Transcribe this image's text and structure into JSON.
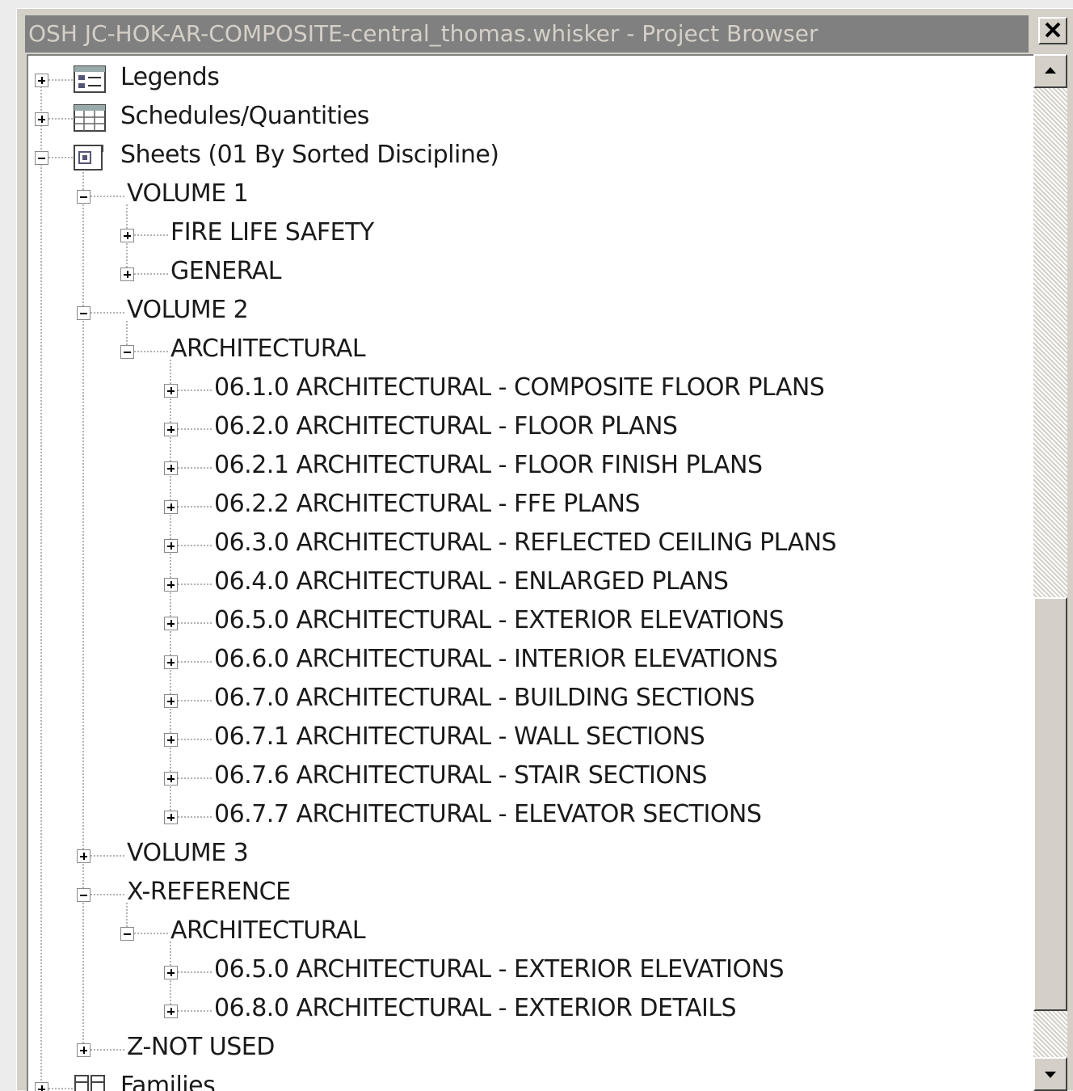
{
  "window": {
    "title": "OSH JC-HOK-AR-COMPOSITE-central_thomas.whisker - Project Browser",
    "close_glyph": "✕"
  },
  "scrollbar": {
    "up_glyph": "▲",
    "down_glyph": "▼"
  },
  "tree": [
    {
      "level": 0,
      "state": "collapsed",
      "icon": "legend-icon",
      "label": "Legends"
    },
    {
      "level": 0,
      "state": "collapsed",
      "icon": "schedule-icon",
      "label": "Schedules/Quantities"
    },
    {
      "level": 0,
      "state": "expanded",
      "icon": "sheets-icon",
      "label": "Sheets (01 By Sorted Discipline)"
    },
    {
      "level": 1,
      "state": "expanded",
      "label": "VOLUME 1"
    },
    {
      "level": 2,
      "state": "collapsed",
      "label": "FIRE LIFE SAFETY"
    },
    {
      "level": 2,
      "state": "collapsed",
      "label": "GENERAL"
    },
    {
      "level": 1,
      "state": "expanded",
      "label": "VOLUME 2"
    },
    {
      "level": 2,
      "state": "expanded",
      "label": "ARCHITECTURAL"
    },
    {
      "level": 3,
      "state": "collapsed",
      "label": "06.1.0 ARCHITECTURAL - COMPOSITE FLOOR PLANS"
    },
    {
      "level": 3,
      "state": "collapsed",
      "label": "06.2.0 ARCHITECTURAL - FLOOR PLANS"
    },
    {
      "level": 3,
      "state": "collapsed",
      "label": "06.2.1 ARCHITECTURAL - FLOOR FINISH PLANS"
    },
    {
      "level": 3,
      "state": "collapsed",
      "label": "06.2.2 ARCHITECTURAL - FFE PLANS"
    },
    {
      "level": 3,
      "state": "collapsed",
      "label": "06.3.0 ARCHITECTURAL - REFLECTED CEILING  PLANS"
    },
    {
      "level": 3,
      "state": "collapsed",
      "label": "06.4.0 ARCHITECTURAL - ENLARGED  PLANS"
    },
    {
      "level": 3,
      "state": "collapsed",
      "label": "06.5.0 ARCHITECTURAL - EXTERIOR ELEVATIONS"
    },
    {
      "level": 3,
      "state": "collapsed",
      "label": "06.6.0 ARCHITECTURAL - INTERIOR ELEVATIONS"
    },
    {
      "level": 3,
      "state": "collapsed",
      "label": "06.7.0 ARCHITECTURAL - BUILDING SECTIONS"
    },
    {
      "level": 3,
      "state": "collapsed",
      "label": "06.7.1 ARCHITECTURAL - WALL SECTIONS"
    },
    {
      "level": 3,
      "state": "collapsed",
      "label": "06.7.6 ARCHITECTURAL - STAIR SECTIONS"
    },
    {
      "level": 3,
      "state": "collapsed",
      "label": "06.7.7 ARCHITECTURAL - ELEVATOR SECTIONS"
    },
    {
      "level": 1,
      "state": "collapsed",
      "label": "VOLUME 3"
    },
    {
      "level": 1,
      "state": "expanded",
      "label": "X-REFERENCE"
    },
    {
      "level": 2,
      "state": "expanded",
      "label": "ARCHITECTURAL"
    },
    {
      "level": 3,
      "state": "collapsed",
      "label": "06.5.0 ARCHITECTURAL - EXTERIOR ELEVATIONS"
    },
    {
      "level": 3,
      "state": "collapsed",
      "label": "06.8.0 ARCHITECTURAL - EXTERIOR DETAILS"
    },
    {
      "level": 1,
      "state": "collapsed",
      "label": "Z-NOT USED"
    },
    {
      "level": 0,
      "state": "collapsed",
      "icon": "families-icon",
      "label": "Families"
    }
  ]
}
